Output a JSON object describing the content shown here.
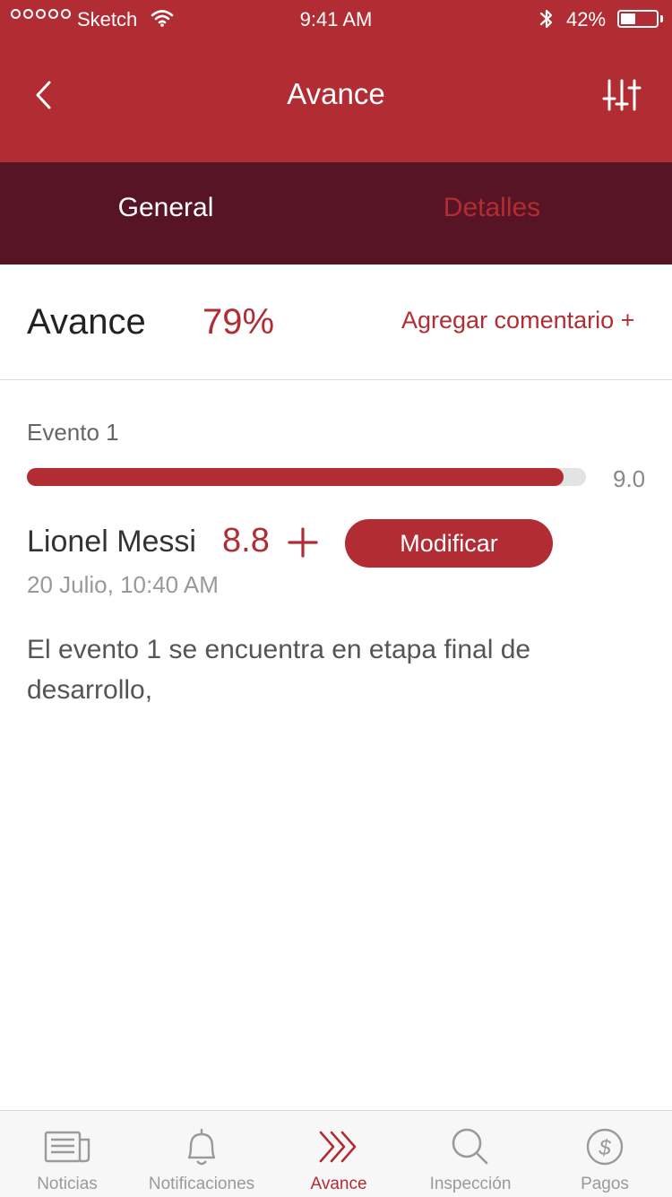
{
  "status_bar": {
    "carrier": "Sketch",
    "time": "9:41 AM",
    "battery_percent": "42%",
    "battery_level": 0.42
  },
  "nav": {
    "title": "Avance",
    "back_icon": "chevron-left-icon",
    "filter_icon": "sliders-icon"
  },
  "segments": [
    {
      "label": "General",
      "selected": true
    },
    {
      "label": "Detalles",
      "selected": false
    }
  ],
  "summary": {
    "label": "Avance",
    "percent": "79%",
    "add_comment": "Agregar comentario +"
  },
  "event": {
    "title": "Evento 1",
    "progress_value": 8.8,
    "max_value": 9.0,
    "max_label": "9.0",
    "progress_fraction": 0.96,
    "user_name": "Lionel Messi",
    "score": "8.8",
    "modify_label": "Modificar",
    "date": "20 Julio, 10:40 AM",
    "comment": "El evento 1 se encuentra en etapa final de desarrollo,"
  },
  "tabs": [
    {
      "label": "Noticias",
      "icon": "newspaper-icon",
      "active": false
    },
    {
      "label": "Notificaciones",
      "icon": "bell-icon",
      "active": false
    },
    {
      "label": "Avance",
      "icon": "chevrons-right-icon",
      "active": true
    },
    {
      "label": "Inspección",
      "icon": "search-icon",
      "active": false
    },
    {
      "label": "Pagos",
      "icon": "dollar-icon",
      "active": false
    }
  ],
  "colors": {
    "primary": "#b22d33",
    "segment_bg": "#561424",
    "track": "#e3e3e3",
    "tab_inactive": "#9a9a9a"
  }
}
